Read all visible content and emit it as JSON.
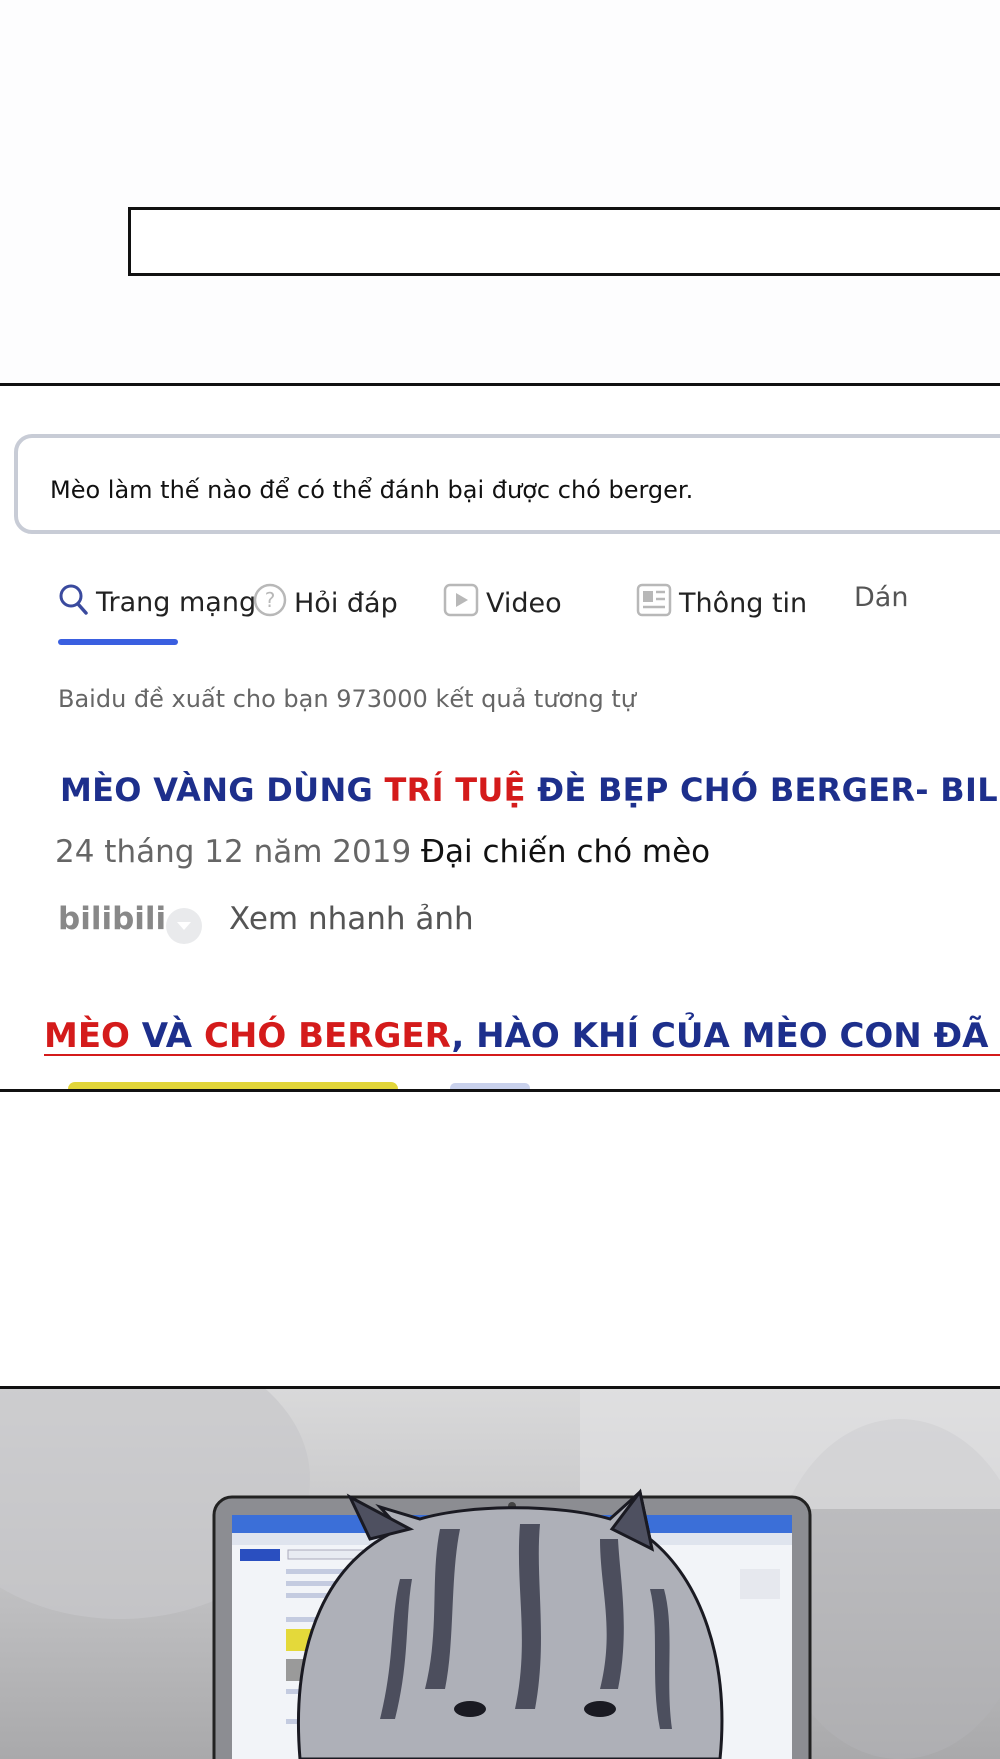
{
  "search": {
    "query": "Mèo làm thế nào để có thể đánh bại được chó berger."
  },
  "tabs": [
    {
      "label": "Trang mạng",
      "icon": "search-icon",
      "active": true
    },
    {
      "label": "Hỏi đáp",
      "icon": "question-icon"
    },
    {
      "label": "Video",
      "icon": "video-icon"
    },
    {
      "label": "Thông tin",
      "icon": "news-icon"
    },
    {
      "label": "Dán",
      "icon": ""
    }
  ],
  "results": {
    "count_text": "Baidu đề xuất cho bạn 973000 kết quả tương tự",
    "r1": {
      "title_part1": "MÈO VÀNG DÙNG ",
      "title_highlight": "TRÍ TUỆ",
      "title_part2": " ĐÈ BẸP CHÓ BERGER- BILIBILI",
      "date": "24 tháng 12 năm 2019",
      "desc": "Đại chiến chó mèo",
      "source": "bilibili",
      "quick_view": "Xem nhanh ảnh"
    },
    "r2": {
      "title_hl1": "MÈO",
      "title_mid1": " VÀ ",
      "title_hl2": "CHÓ BERGER",
      "title_rest": ", HÀO KHÍ CỦA MÈO CON ĐÃ LÀM CON C"
    }
  },
  "colors": {
    "link_blue": "#1d2f8c",
    "highlight_red": "#d41b1b",
    "tab_underline": "#3a5fe0",
    "search_border": "#c8ccd6"
  }
}
